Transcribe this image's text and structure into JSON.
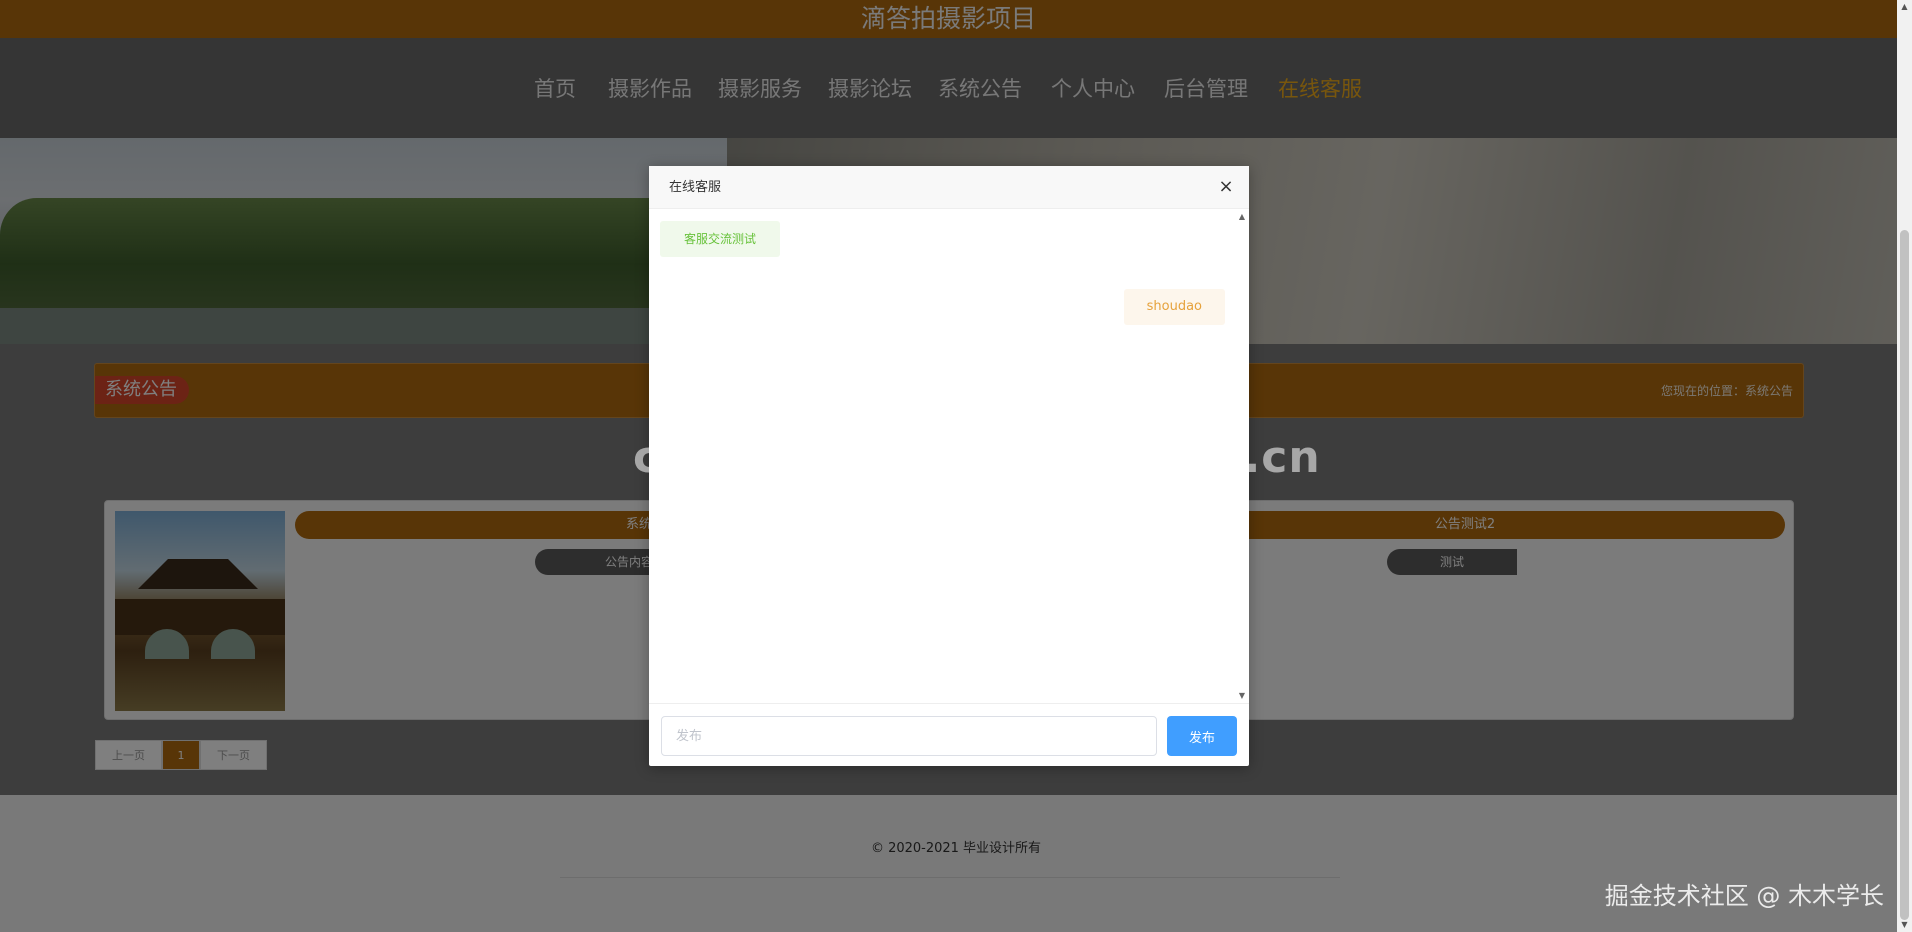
{
  "site": {
    "title": "滴答拍摄影项目"
  },
  "nav": {
    "items": [
      {
        "label": "首页"
      },
      {
        "label": "摄影作品"
      },
      {
        "label": "摄影服务"
      },
      {
        "label": "摄影论坛"
      },
      {
        "label": "系统公告"
      },
      {
        "label": "个人中心"
      },
      {
        "label": "后台管理"
      },
      {
        "label": "在线客服",
        "active": true
      }
    ]
  },
  "section": {
    "title": "系统公告",
    "breadcrumb": "您现在的位置：系统公告"
  },
  "notices": [
    {
      "title": "系统公告测试",
      "content": "公告内容测"
    },
    {
      "title": "公告测试2",
      "content": "测试"
    }
  ],
  "pagination": {
    "prev": "上一页",
    "current": "1",
    "next": "下一页"
  },
  "footer": {
    "copyright": "© 2020-2021 毕业设计所有"
  },
  "chat_modal": {
    "title": "在线客服",
    "close": "×",
    "messages": [
      {
        "side": "left",
        "text": "客服交流测试"
      },
      {
        "side": "right",
        "text": "shoudao"
      }
    ],
    "input_placeholder": "发布",
    "send_label": "发布"
  },
  "watermarks": {
    "center": "cn围观客www.weiguanke.cn",
    "corner": "掘金技术社区 @ 木木学长"
  },
  "colors": {
    "brand": "#b06a0f",
    "nav_active": "#f0ad1a",
    "primary_button": "#409eff",
    "msg_left_text": "#67c23a",
    "msg_right_text": "#e6a23c"
  }
}
